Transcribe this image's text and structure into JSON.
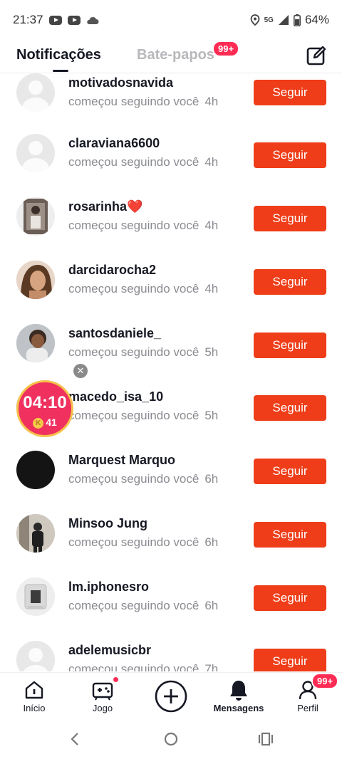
{
  "status_bar": {
    "time": "21:37",
    "network": "5G",
    "battery": "64%"
  },
  "header": {
    "tab_notifications": "Notificações",
    "tab_chats": "Bate-papos",
    "chats_badge": "99+"
  },
  "notifications": [
    {
      "username": "motivadosnavida",
      "text": "começou seguindo você",
      "time": "4h",
      "button": "Seguir",
      "avatar": "default"
    },
    {
      "username": "claraviana6600",
      "text": "começou seguindo você",
      "time": "4h",
      "button": "Seguir",
      "avatar": "default"
    },
    {
      "username": "rosarinha❤️",
      "text": "começou seguindo você",
      "time": "4h",
      "button": "Seguir",
      "avatar": "photo"
    },
    {
      "username": "darcidarocha2",
      "text": "começou seguindo você",
      "time": "4h",
      "button": "Seguir",
      "avatar": "photo"
    },
    {
      "username": "santosdaniele_",
      "text": "começou seguindo você",
      "time": "5h",
      "button": "Seguir",
      "avatar": "photo"
    },
    {
      "username": "macedo_isa_10",
      "text": "começou seguindo você",
      "time": "5h",
      "button": "Seguir",
      "avatar": "photo"
    },
    {
      "username": "Marquest Marquo",
      "text": "começou seguindo você",
      "time": "6h",
      "button": "Seguir",
      "avatar": "black"
    },
    {
      "username": "Minsoo Jung",
      "text": "começou seguindo você",
      "time": "6h",
      "button": "Seguir",
      "avatar": "photo"
    },
    {
      "username": "lm.iphonesro",
      "text": "começou seguindo você",
      "time": "6h",
      "button": "Seguir",
      "avatar": "photo"
    },
    {
      "username": "adelemusicbr",
      "text": "começou seguindo você",
      "time": "7h",
      "button": "Seguir",
      "avatar": "default"
    }
  ],
  "floating_timer": {
    "time": "04:10",
    "coin_letter": "K",
    "coins": "41"
  },
  "bottom_nav": {
    "home": "Início",
    "game": "Jogo",
    "messages": "Mensagens",
    "profile": "Perfil",
    "profile_badge": "99+"
  },
  "colors": {
    "follow_button": "#ee3d18",
    "badge": "#fe2c55",
    "timer": "#f0305f"
  }
}
